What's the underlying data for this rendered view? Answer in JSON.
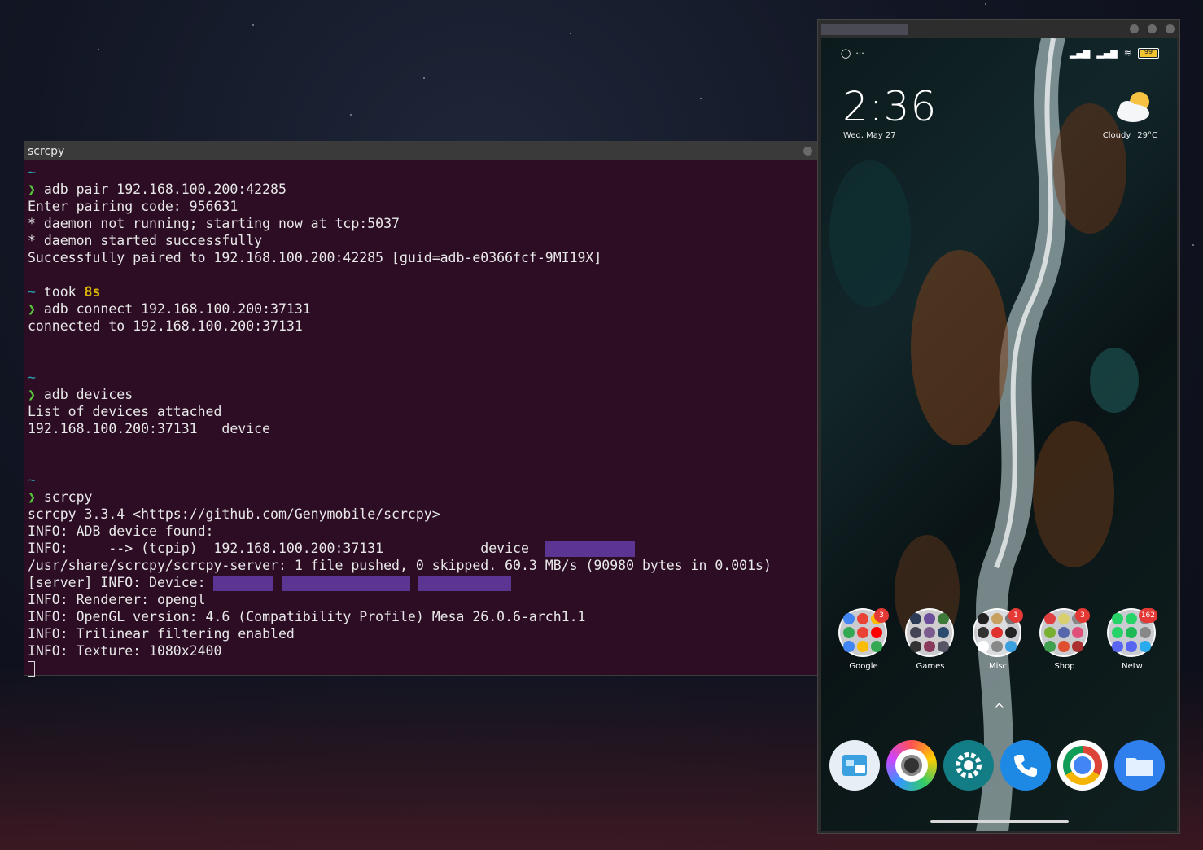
{
  "terminal": {
    "title": "scrcpy",
    "lines": [
      {
        "type": "tilde",
        "text": "~"
      },
      {
        "type": "cmd",
        "prompt": "❯",
        "text": " adb pair 192.168.100.200:42285"
      },
      {
        "type": "out",
        "text": "Enter pairing code: 956631"
      },
      {
        "type": "out",
        "text": "* daemon not running; starting now at tcp:5037"
      },
      {
        "type": "out",
        "text": "* daemon started successfully"
      },
      {
        "type": "out",
        "text": "Successfully paired to 192.168.100.200:42285 [guid=adb-e0366fcf-9MI19X]"
      },
      {
        "type": "blank",
        "text": ""
      },
      {
        "type": "took",
        "tilde": "~",
        "label": " took ",
        "value": "8s"
      },
      {
        "type": "cmd",
        "prompt": "❯",
        "text": " adb connect 192.168.100.200:37131"
      },
      {
        "type": "out",
        "text": "connected to 192.168.100.200:37131"
      },
      {
        "type": "blank",
        "text": ""
      },
      {
        "type": "blank",
        "text": ""
      },
      {
        "type": "tilde",
        "text": "~"
      },
      {
        "type": "cmd",
        "prompt": "❯",
        "text": " adb devices"
      },
      {
        "type": "out",
        "text": "List of devices attached"
      },
      {
        "type": "out",
        "text": "192.168.100.200:37131   device"
      },
      {
        "type": "blank",
        "text": ""
      },
      {
        "type": "blank",
        "text": ""
      },
      {
        "type": "tilde",
        "text": "~"
      },
      {
        "type": "cmd",
        "prompt": "❯",
        "text": " scrcpy"
      },
      {
        "type": "out",
        "text": "scrcpy 3.3.4 <https://github.com/Genymobile/scrcpy>"
      },
      {
        "type": "out",
        "text": "INFO: ADB device found:"
      },
      {
        "type": "redact1",
        "text": "INFO:     --> (tcpip)  192.168.100.200:37131            device  "
      },
      {
        "type": "out",
        "text": "/usr/share/scrcpy/scrcpy-server: 1 file pushed, 0 skipped. 60.3 MB/s (90980 bytes in 0.001s)"
      },
      {
        "type": "redact2",
        "text": "[server] INFO: Device: "
      },
      {
        "type": "out",
        "text": "INFO: Renderer: opengl"
      },
      {
        "type": "out",
        "text": "INFO: OpenGL version: 4.6 (Compatibility Profile) Mesa 26.0.6-arch1.1"
      },
      {
        "type": "out",
        "text": "INFO: Trilinear filtering enabled"
      },
      {
        "type": "out",
        "text": "INFO: Texture: 1080x2400"
      },
      {
        "type": "cursor",
        "text": ""
      }
    ]
  },
  "phone": {
    "status": {
      "battery": "99"
    },
    "clock": "2:36",
    "date": "Wed, May 27",
    "weather": {
      "condition": "Cloudy",
      "temp": "29°C",
      "icon": "partly-cloudy-icon"
    },
    "folders": [
      {
        "label": "Google",
        "badge": "3",
        "colors": [
          "#4285f4",
          "#ea4335",
          "#fbbc05",
          "#34a853",
          "#ea4335",
          "#ff0000",
          "#4285f4",
          "#fbbc05",
          "#34a853"
        ]
      },
      {
        "label": "Games",
        "badge": "",
        "colors": [
          "#2e3b55",
          "#6b4e9b",
          "#3d7a3a",
          "#445",
          "#7a5c8f",
          "#2b4b6f",
          "#333",
          "#8a3a5a",
          "#556"
        ]
      },
      {
        "label": "Misc",
        "badge": "1",
        "colors": [
          "#222",
          "#c8a060",
          "#777",
          "#333",
          "#e03030",
          "#222",
          "#fff",
          "#888",
          "#3aa0e0"
        ]
      },
      {
        "label": "Shop",
        "badge": "3",
        "colors": [
          "#e04040",
          "#d8d070",
          "#888",
          "#7ab030",
          "#5566aa",
          "#e0507a",
          "#40a050",
          "#e05030",
          "#aa3030"
        ]
      },
      {
        "label": "Netw",
        "badge": "162",
        "colors": [
          "#25d366",
          "#25d366",
          "#888",
          "#25d366",
          "#1db954",
          "#888",
          "#5865f2",
          "#5865f2",
          "#2aabee"
        ]
      }
    ],
    "dock": [
      {
        "name": "gallery-icon",
        "bg": "#e8eef6"
      },
      {
        "name": "camera-icon",
        "bg": "#ffffff"
      },
      {
        "name": "settings-icon",
        "bg": "#137d85"
      },
      {
        "name": "phone-icon",
        "bg": "#1e88e5"
      },
      {
        "name": "chrome-icon",
        "bg": "#ffffff"
      },
      {
        "name": "files-icon",
        "bg": "#2f80ed"
      }
    ]
  }
}
